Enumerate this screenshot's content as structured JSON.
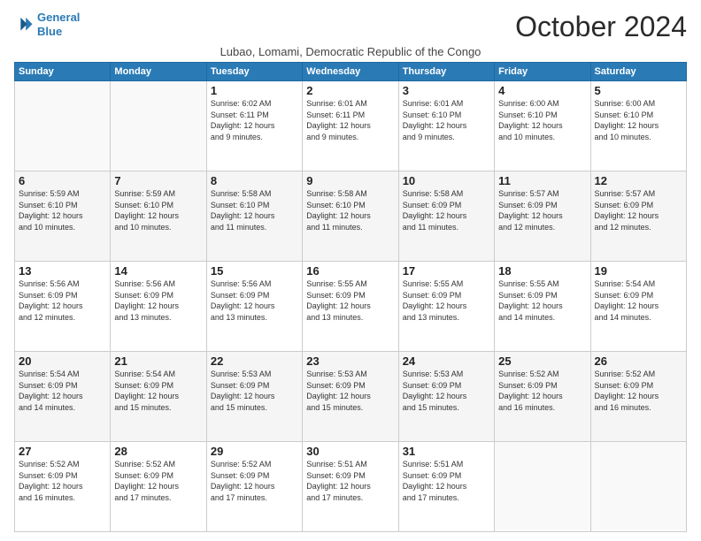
{
  "logo": {
    "line1": "General",
    "line2": "Blue"
  },
  "title": "October 2024",
  "location": "Lubao, Lomami, Democratic Republic of the Congo",
  "days_of_week": [
    "Sunday",
    "Monday",
    "Tuesday",
    "Wednesday",
    "Thursday",
    "Friday",
    "Saturday"
  ],
  "weeks": [
    [
      {
        "day": "",
        "info": ""
      },
      {
        "day": "",
        "info": ""
      },
      {
        "day": "1",
        "info": "Sunrise: 6:02 AM\nSunset: 6:11 PM\nDaylight: 12 hours\nand 9 minutes."
      },
      {
        "day": "2",
        "info": "Sunrise: 6:01 AM\nSunset: 6:11 PM\nDaylight: 12 hours\nand 9 minutes."
      },
      {
        "day": "3",
        "info": "Sunrise: 6:01 AM\nSunset: 6:10 PM\nDaylight: 12 hours\nand 9 minutes."
      },
      {
        "day": "4",
        "info": "Sunrise: 6:00 AM\nSunset: 6:10 PM\nDaylight: 12 hours\nand 10 minutes."
      },
      {
        "day": "5",
        "info": "Sunrise: 6:00 AM\nSunset: 6:10 PM\nDaylight: 12 hours\nand 10 minutes."
      }
    ],
    [
      {
        "day": "6",
        "info": "Sunrise: 5:59 AM\nSunset: 6:10 PM\nDaylight: 12 hours\nand 10 minutes."
      },
      {
        "day": "7",
        "info": "Sunrise: 5:59 AM\nSunset: 6:10 PM\nDaylight: 12 hours\nand 10 minutes."
      },
      {
        "day": "8",
        "info": "Sunrise: 5:58 AM\nSunset: 6:10 PM\nDaylight: 12 hours\nand 11 minutes."
      },
      {
        "day": "9",
        "info": "Sunrise: 5:58 AM\nSunset: 6:10 PM\nDaylight: 12 hours\nand 11 minutes."
      },
      {
        "day": "10",
        "info": "Sunrise: 5:58 AM\nSunset: 6:09 PM\nDaylight: 12 hours\nand 11 minutes."
      },
      {
        "day": "11",
        "info": "Sunrise: 5:57 AM\nSunset: 6:09 PM\nDaylight: 12 hours\nand 12 minutes."
      },
      {
        "day": "12",
        "info": "Sunrise: 5:57 AM\nSunset: 6:09 PM\nDaylight: 12 hours\nand 12 minutes."
      }
    ],
    [
      {
        "day": "13",
        "info": "Sunrise: 5:56 AM\nSunset: 6:09 PM\nDaylight: 12 hours\nand 12 minutes."
      },
      {
        "day": "14",
        "info": "Sunrise: 5:56 AM\nSunset: 6:09 PM\nDaylight: 12 hours\nand 13 minutes."
      },
      {
        "day": "15",
        "info": "Sunrise: 5:56 AM\nSunset: 6:09 PM\nDaylight: 12 hours\nand 13 minutes."
      },
      {
        "day": "16",
        "info": "Sunrise: 5:55 AM\nSunset: 6:09 PM\nDaylight: 12 hours\nand 13 minutes."
      },
      {
        "day": "17",
        "info": "Sunrise: 5:55 AM\nSunset: 6:09 PM\nDaylight: 12 hours\nand 13 minutes."
      },
      {
        "day": "18",
        "info": "Sunrise: 5:55 AM\nSunset: 6:09 PM\nDaylight: 12 hours\nand 14 minutes."
      },
      {
        "day": "19",
        "info": "Sunrise: 5:54 AM\nSunset: 6:09 PM\nDaylight: 12 hours\nand 14 minutes."
      }
    ],
    [
      {
        "day": "20",
        "info": "Sunrise: 5:54 AM\nSunset: 6:09 PM\nDaylight: 12 hours\nand 14 minutes."
      },
      {
        "day": "21",
        "info": "Sunrise: 5:54 AM\nSunset: 6:09 PM\nDaylight: 12 hours\nand 15 minutes."
      },
      {
        "day": "22",
        "info": "Sunrise: 5:53 AM\nSunset: 6:09 PM\nDaylight: 12 hours\nand 15 minutes."
      },
      {
        "day": "23",
        "info": "Sunrise: 5:53 AM\nSunset: 6:09 PM\nDaylight: 12 hours\nand 15 minutes."
      },
      {
        "day": "24",
        "info": "Sunrise: 5:53 AM\nSunset: 6:09 PM\nDaylight: 12 hours\nand 15 minutes."
      },
      {
        "day": "25",
        "info": "Sunrise: 5:52 AM\nSunset: 6:09 PM\nDaylight: 12 hours\nand 16 minutes."
      },
      {
        "day": "26",
        "info": "Sunrise: 5:52 AM\nSunset: 6:09 PM\nDaylight: 12 hours\nand 16 minutes."
      }
    ],
    [
      {
        "day": "27",
        "info": "Sunrise: 5:52 AM\nSunset: 6:09 PM\nDaylight: 12 hours\nand 16 minutes."
      },
      {
        "day": "28",
        "info": "Sunrise: 5:52 AM\nSunset: 6:09 PM\nDaylight: 12 hours\nand 17 minutes."
      },
      {
        "day": "29",
        "info": "Sunrise: 5:52 AM\nSunset: 6:09 PM\nDaylight: 12 hours\nand 17 minutes."
      },
      {
        "day": "30",
        "info": "Sunrise: 5:51 AM\nSunset: 6:09 PM\nDaylight: 12 hours\nand 17 minutes."
      },
      {
        "day": "31",
        "info": "Sunrise: 5:51 AM\nSunset: 6:09 PM\nDaylight: 12 hours\nand 17 minutes."
      },
      {
        "day": "",
        "info": ""
      },
      {
        "day": "",
        "info": ""
      }
    ]
  ]
}
